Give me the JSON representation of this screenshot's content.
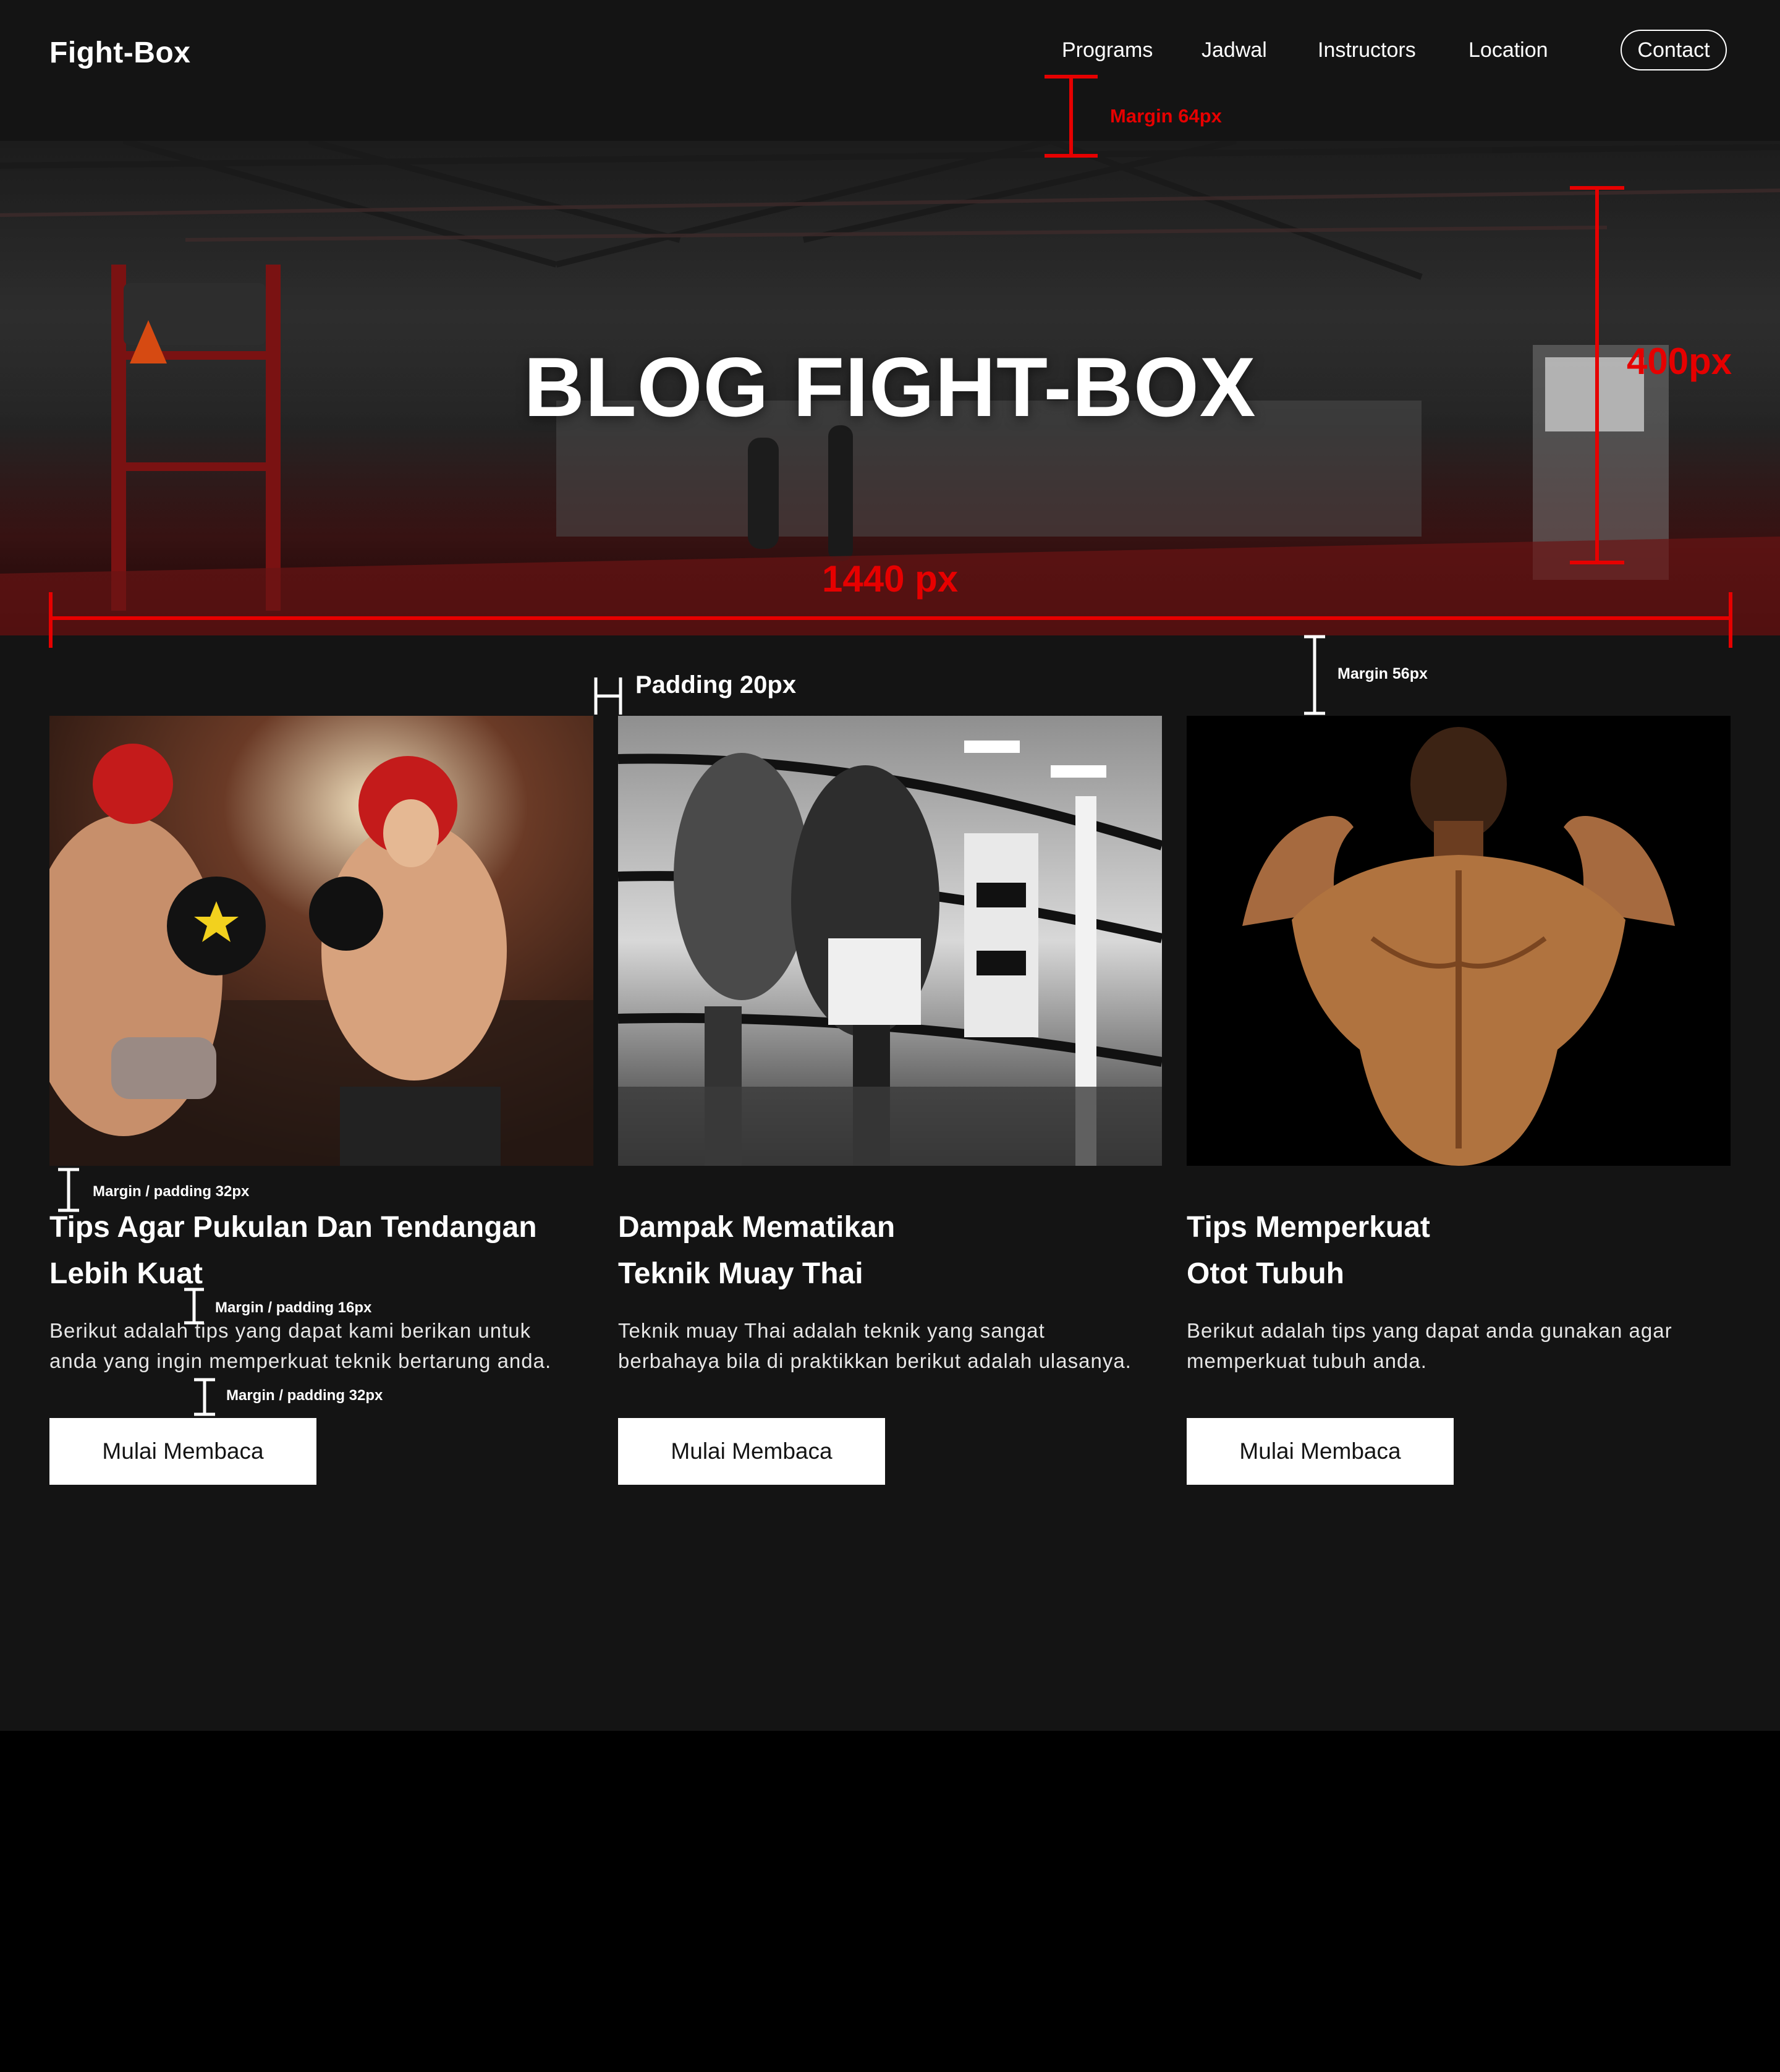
{
  "nav": {
    "brand": "Fight-Box",
    "links": [
      "Programs",
      "Jadwal",
      "Instructors",
      "Location"
    ],
    "contact": "Contact"
  },
  "hero": {
    "title": "BLOG FIGHT-BOX"
  },
  "annotations": {
    "margin_64": "Margin 64px",
    "height_400": "400px",
    "width_1440": "1440 px",
    "padding_20": "Padding 20px",
    "margin_56": "Margin 56px",
    "margin_padding_32_a": "Margin / padding 32px",
    "margin_padding_16": "Margin / padding 16px",
    "margin_padding_32_b": "Margin / padding 32px"
  },
  "cards": [
    {
      "title_line1": "Tips Agar Pukulan Dan Tendangan",
      "title_line2": "Lebih Kuat",
      "text_line1": "Berikut adalah tips yang dapat kami berikan untuk",
      "text_line2": "anda yang ingin memperkuat teknik bertarung anda.",
      "button": "Mulai Membaca",
      "image": "boxing-sparring-photo"
    },
    {
      "title_line1": "Dampak Mematikan",
      "title_line2": "Teknik Muay Thai",
      "text_line1": "Teknik muay Thai adalah teknik yang sangat",
      "text_line2": "berbahaya bila di praktikkan berikut adalah ulasanya.",
      "button": "Mulai Membaca",
      "image": "muay-thai-ring-photo"
    },
    {
      "title_line1": "Tips Memperkuat",
      "title_line2": "Otot Tubuh",
      "text_line1": "Berikut adalah tips yang dapat anda gunakan agar",
      "text_line2": "memperkuat tubuh anda.",
      "button": "Mulai Membaca",
      "image": "muscular-back-photo"
    }
  ],
  "colors": {
    "background": "#141414",
    "annotation_red": "#e60000",
    "button_bg": "#ffffff"
  }
}
